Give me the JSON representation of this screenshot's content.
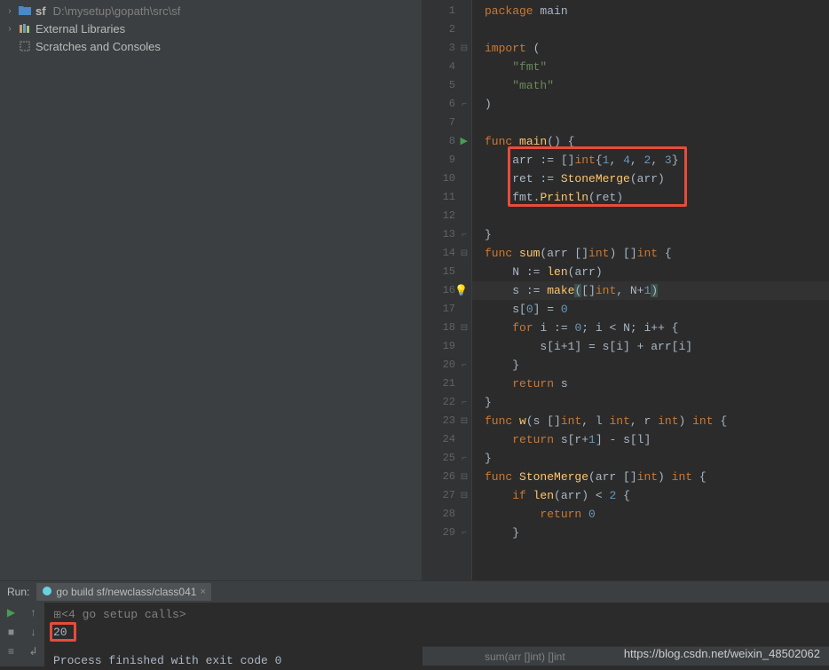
{
  "project": {
    "root_name": "sf",
    "root_path": "D:\\mysetup\\gopath\\src\\sf",
    "ext_libs": "External Libraries",
    "scratches": "Scratches and Consoles"
  },
  "code": {
    "l1": "package main",
    "l3": "import (",
    "l4": "\"fmt\"",
    "l5": "\"math\"",
    "l6": ")",
    "l8": "func main() {",
    "l9a": "arr := []",
    "l9b": "int",
    "l9c": "{1, 4, 2, 3}",
    "l10a": "ret := ",
    "l10b": "StoneMerge",
    "l10c": "(arr)",
    "l11a": "fmt.",
    "l11b": "Println",
    "l11c": "(ret)",
    "l13": "}",
    "l14a": "func ",
    "l14b": "sum",
    "l14c": "(arr []int) []int {",
    "l15a": "N := ",
    "l15b": "len",
    "l15c": "(arr)",
    "l16a": "s := ",
    "l16b": "make",
    "l16c": "([]int, N+1)",
    "l17a": "s[",
    "l17b": "0",
    "l17c": "] = ",
    "l17d": "0",
    "l18a": "for i := ",
    "l18b": "0",
    "l18c": "; i < N; i++ {",
    "l19": "s[i+1] = s[i] + arr[i]",
    "l20": "}",
    "l21a": "return ",
    "l21b": "s",
    "l22": "}",
    "l23a": "func ",
    "l23b": "w",
    "l23c": "(s []int, l int, r int) int {",
    "l24a": "return ",
    "l24b": "s[r+1] - s[l]",
    "l25": "}",
    "l26a": "func ",
    "l26b": "StoneMerge",
    "l26c": "(arr []int) int {",
    "l27a": "if ",
    "l27b": "len",
    "l27c": "(arr) < ",
    "l27d": "2",
    "l27e": " {",
    "l28a": "return ",
    "l28b": "0",
    "l29": "}"
  },
  "breadcrumb": "sum(arr []int) []int",
  "run": {
    "panel_label": "Run:",
    "tab_label": "go build sf/newclass/class041",
    "setup_line": "<4 go setup calls>",
    "output_value": "20",
    "exit_line": "Process finished with exit code 0"
  },
  "watermark": "https://blog.csdn.net/weixin_48502062"
}
